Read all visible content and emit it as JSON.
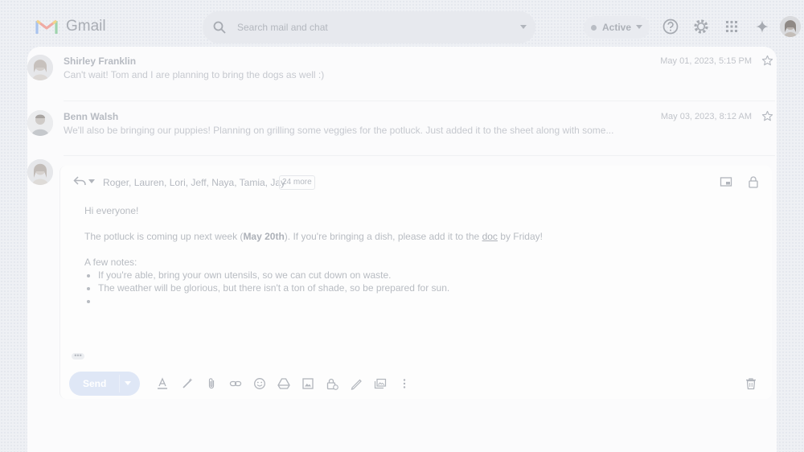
{
  "app": {
    "name": "Gmail"
  },
  "search": {
    "placeholder": "Search mail and chat"
  },
  "status": {
    "label": "Active"
  },
  "colors": {
    "text_muted": "#b5b9c0",
    "panel": "#fbfbfc",
    "send_button": "#dfe7f6"
  },
  "icons": {
    "top_right": [
      "help-icon",
      "settings-icon",
      "apps-grid-icon",
      "gemini-sparkle-icon"
    ],
    "compose_tools": [
      "text-format-icon",
      "magic-pen-icon",
      "attachment-icon",
      "link-icon",
      "emoji-icon",
      "drive-icon",
      "photo-icon",
      "confidential-lock-icon",
      "signature-icon",
      "template-icon",
      "more-vertical-icon"
    ]
  },
  "messages": [
    {
      "sender": "Shirley Franklin",
      "snippet": "Can't wait! Tom and I are planning to bring the dogs as well :)",
      "date": "May 01, 2023, 5:15 PM"
    },
    {
      "sender": "Benn Walsh",
      "snippet": "We'll also be bringing our puppies! Planning on grilling some veggies for the potluck. Just added it to the sheet along with some...",
      "date": "May 03, 2023, 8:12 AM"
    }
  ],
  "compose": {
    "recipients": "Roger, Lauren, Lori, Jeff, Naya, Tamia, Jay",
    "more_count": "24 more",
    "greeting": "Hi everyone!",
    "line1_pre": "The potluck is coming up next week (",
    "line1_bold": "May 20th",
    "line1_mid": "). If you're bringing a dish, please add it to the ",
    "line1_link": "doc",
    "line1_post": " by Friday!",
    "notes_heading": "A few notes:",
    "notes": [
      "If you're able, bring your own utensils, so we can cut down on waste.",
      "The weather will be glorious, but there isn't a ton of shade, so be prepared for sun.",
      ""
    ],
    "ellipsis": "•••",
    "send_label": "Send"
  }
}
